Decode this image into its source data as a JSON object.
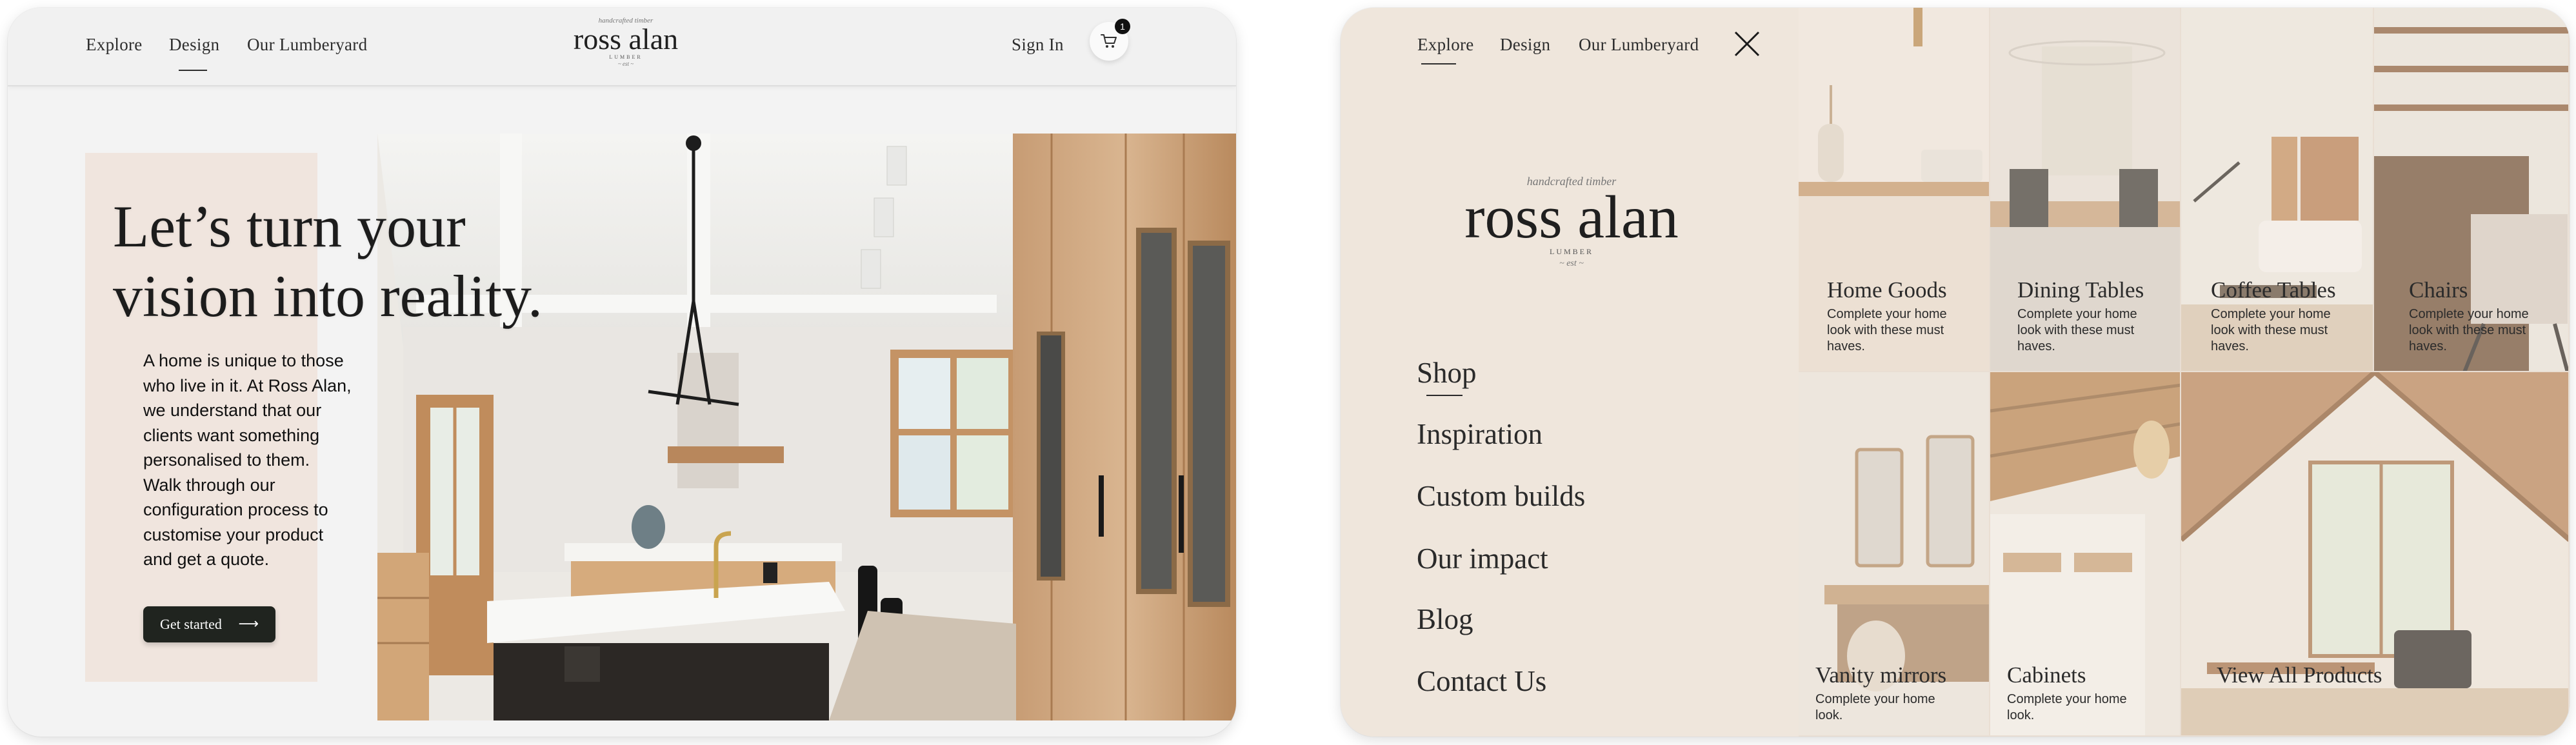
{
  "colors": {
    "accent_dark": "#20241f",
    "page_bg": "#f3f3f3",
    "panel_beige": "#f0e5de",
    "menu_bg": "#efe6dc",
    "badge": "#111111"
  },
  "left": {
    "nav": {
      "explore": "Explore",
      "design": "Design",
      "lumberyard": "Our Lumberyard",
      "active": "Design"
    },
    "logo": {
      "script": "handcrafted timber",
      "name": "ross alan",
      "sub": "LUMBER",
      "mark": "~ est ~"
    },
    "sign_in": "Sign In",
    "cart": {
      "icon": "cart-icon",
      "count": "1"
    },
    "hero": {
      "title_line1": "Let’s turn your",
      "title_line2": "vision into reality.",
      "copy": [
        "A home is unique to those",
        "who live in it. At Ross Alan,",
        "we understand that our",
        "clients want something",
        "personalised to them.",
        "Walk through our",
        "configuration process to",
        "customise your product",
        "and get a quote."
      ],
      "cta_label": "Get started",
      "cta_icon": "arrow-right-icon"
    }
  },
  "right": {
    "nav": {
      "explore": "Explore",
      "design": "Design",
      "lumberyard": "Our Lumberyard",
      "active": "Explore"
    },
    "close_icon": "close-icon",
    "logo": {
      "script": "handcrafted timber",
      "name": "ross alan",
      "sub": "LUMBER",
      "mark": "~ est ~"
    },
    "menu": [
      "Shop",
      "Inspiration",
      "Custom builds",
      "Our impact",
      "Blog",
      "Contact Us"
    ],
    "menu_active": "Shop",
    "categories": [
      {
        "title": "Home Goods",
        "desc": "Complete your home look with these must haves."
      },
      {
        "title": "Dining Tables",
        "desc": "Complete your home look with these must haves."
      },
      {
        "title": "Coffee Tables",
        "desc": "Complete your home look with these must haves."
      },
      {
        "title": "Chairs",
        "desc": "Complete your home look with these must haves."
      },
      {
        "title": "Vanity mirrors",
        "desc": "Complete your home look."
      },
      {
        "title": "Cabinets",
        "desc": "Complete your home look."
      },
      {
        "title": "View All Products",
        "desc": ""
      }
    ]
  }
}
